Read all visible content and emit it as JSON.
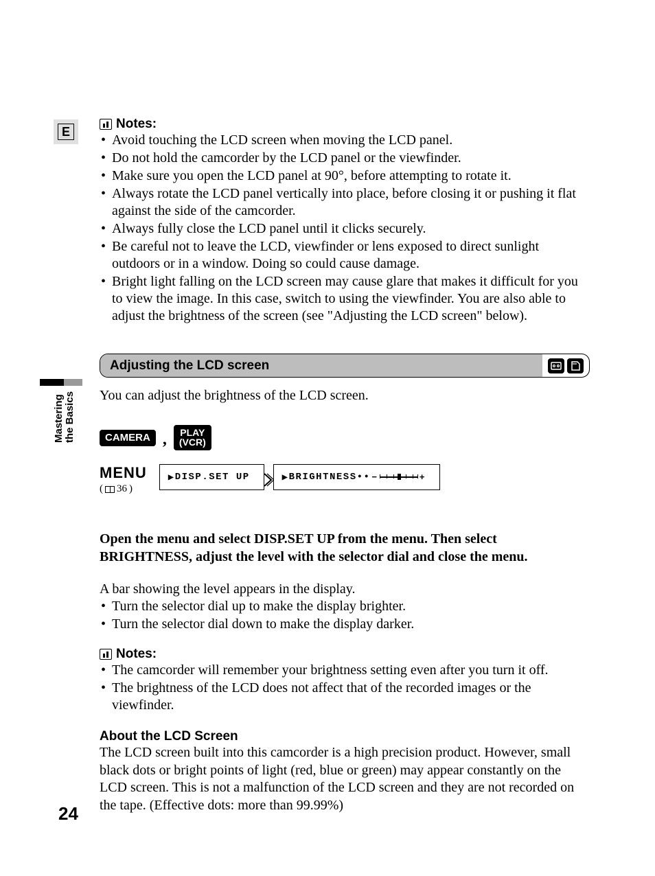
{
  "lang_tab": "E",
  "side_label_line1": "Mastering",
  "side_label_line2": "the Basics",
  "notes_label": "Notes:",
  "notes1": [
    "Avoid touching the LCD screen when moving the LCD panel.",
    "Do not hold the camcorder by the LCD panel or the viewfinder.",
    "Make sure you open the LCD panel at 90°, before attempting to rotate it.",
    "Always rotate the LCD panel vertically into place, before closing it or pushing it flat against the side of the camcorder.",
    "Always fully close the LCD panel until it clicks securely.",
    "Be careful not to leave the LCD, viewfinder or lens exposed to direct sunlight outdoors or in a window. Doing so could cause damage.",
    "Bright light falling on the LCD screen may cause glare that makes it difficult for you to view the image. In this case, switch to using the viewfinder. You are also able to adjust the brightness of the screen (see \"Adjusting the LCD screen\" below)."
  ],
  "section_title": "Adjusting the LCD screen",
  "intro": "You can adjust the brightness of the LCD screen.",
  "mode_camera": "CAMERA",
  "mode_play_line1": "PLAY",
  "mode_play_line2": "(VCR)",
  "menu_label": "MENU",
  "menu_page_ref": "36",
  "menu_item1": "DISP.SET UP",
  "menu_item2": "BRIGHTNESS",
  "instruction": "Open the menu and select DISP.SET UP from the menu. Then select BRIGHTNESS, adjust the level with the selector dial and close the menu.",
  "body_p": "A bar showing the level appears in the display.",
  "bullets2": [
    "Turn the selector dial up to make the display brighter.",
    "Turn the selector dial down to make the display darker."
  ],
  "notes2": [
    "The camcorder will remember your brightness setting even after you turn it off.",
    "The brightness of the LCD does not affect that of the recorded images or the viewfinder."
  ],
  "about_head": "About the LCD Screen",
  "about_body": "The LCD screen built into this camcorder is a high precision product. However, small black dots or bright points of light (red, blue or green) may appear constantly on the LCD screen. This is not a malfunction of the LCD screen and they are not recorded on the tape. (Effective dots: more than 99.99%)",
  "page_number": "24"
}
